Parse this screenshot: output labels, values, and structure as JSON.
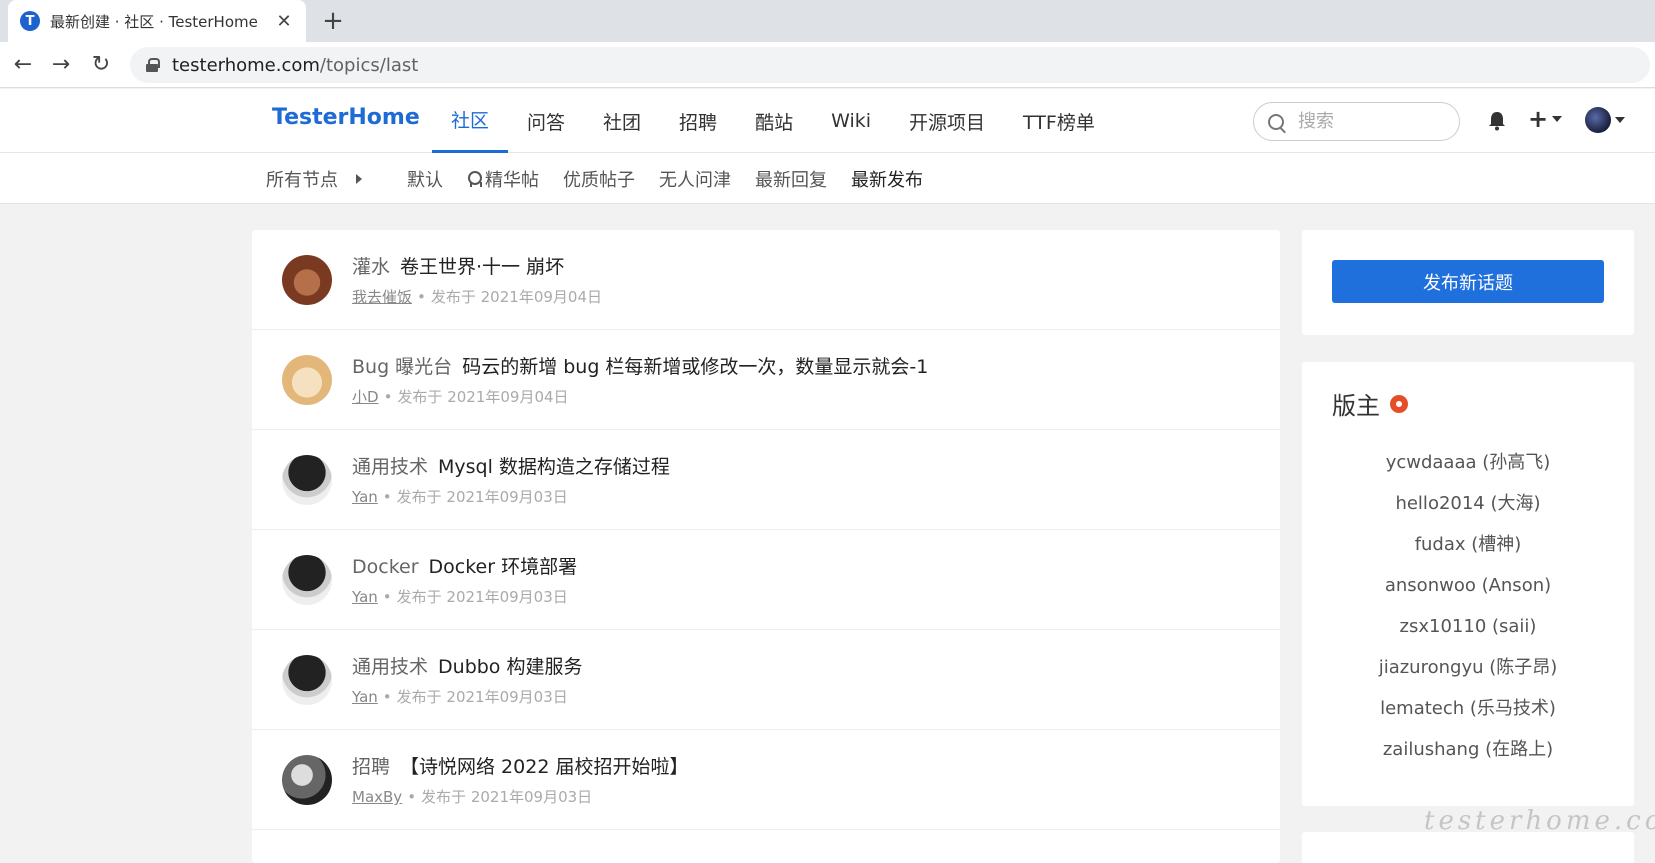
{
  "browser": {
    "tab_title": "最新创建 · 社区 · TesterHome",
    "tab_favicon": "T",
    "new_tab": "+",
    "url_host": "testerhome.com",
    "url_path": "/topics/last"
  },
  "header": {
    "brand": "TesterHome",
    "nav": [
      "社区",
      "问答",
      "社团",
      "招聘",
      "酷站",
      "Wiki",
      "开源项目",
      "TTF榜单"
    ],
    "active_nav": "社区",
    "search_placeholder": "搜索",
    "plus": "+"
  },
  "subnav": {
    "node_selector": "所有节点",
    "filters": [
      "默认",
      "精华帖",
      "优质帖子",
      "无人问津",
      "最新回复",
      "最新发布"
    ],
    "active_filter": "最新发布"
  },
  "topics": [
    {
      "node": "灌水",
      "title": "卷王世界·十一 崩坏",
      "author": "我去催饭",
      "published": "发布于 2021年09月04日"
    },
    {
      "node": "Bug 曝光台",
      "title": "码云的新增 bug 栏每新增或修改一次，数量显示就会-1",
      "author": "小D",
      "published": "发布于 2021年09月04日"
    },
    {
      "node": "通用技术",
      "title": "Mysql 数据构造之存储过程",
      "author": "Yan",
      "published": "发布于 2021年09月03日"
    },
    {
      "node": "Docker",
      "title": "Docker 环境部署",
      "author": "Yan",
      "published": "发布于 2021年09月03日"
    },
    {
      "node": "通用技术",
      "title": "Dubbo 构建服务",
      "author": "Yan",
      "published": "发布于 2021年09月03日"
    },
    {
      "node": "招聘",
      "title": "【诗悦网络 2022 届校招开始啦】",
      "author": "MaxBy",
      "published": "发布于 2021年09月03日"
    }
  ],
  "meta_separator": "•",
  "sidebar": {
    "publish_button": "发布新话题",
    "moderators_title": "版主",
    "moderators": [
      "ycwdaaaa (孙高飞)",
      "hello2014 (大海)",
      "fudax (槽神)",
      "ansonwoo (Anson)",
      "zsx10110 (saii)",
      "jiazurongyu (陈子昂)",
      "lematech (乐马技术)",
      "zailushang (在路上)"
    ]
  },
  "watermark": "testerhome.com",
  "colors": {
    "brand": "#1e6bd6",
    "primary_button": "#1f6fdc",
    "badge": "#e54e27"
  }
}
